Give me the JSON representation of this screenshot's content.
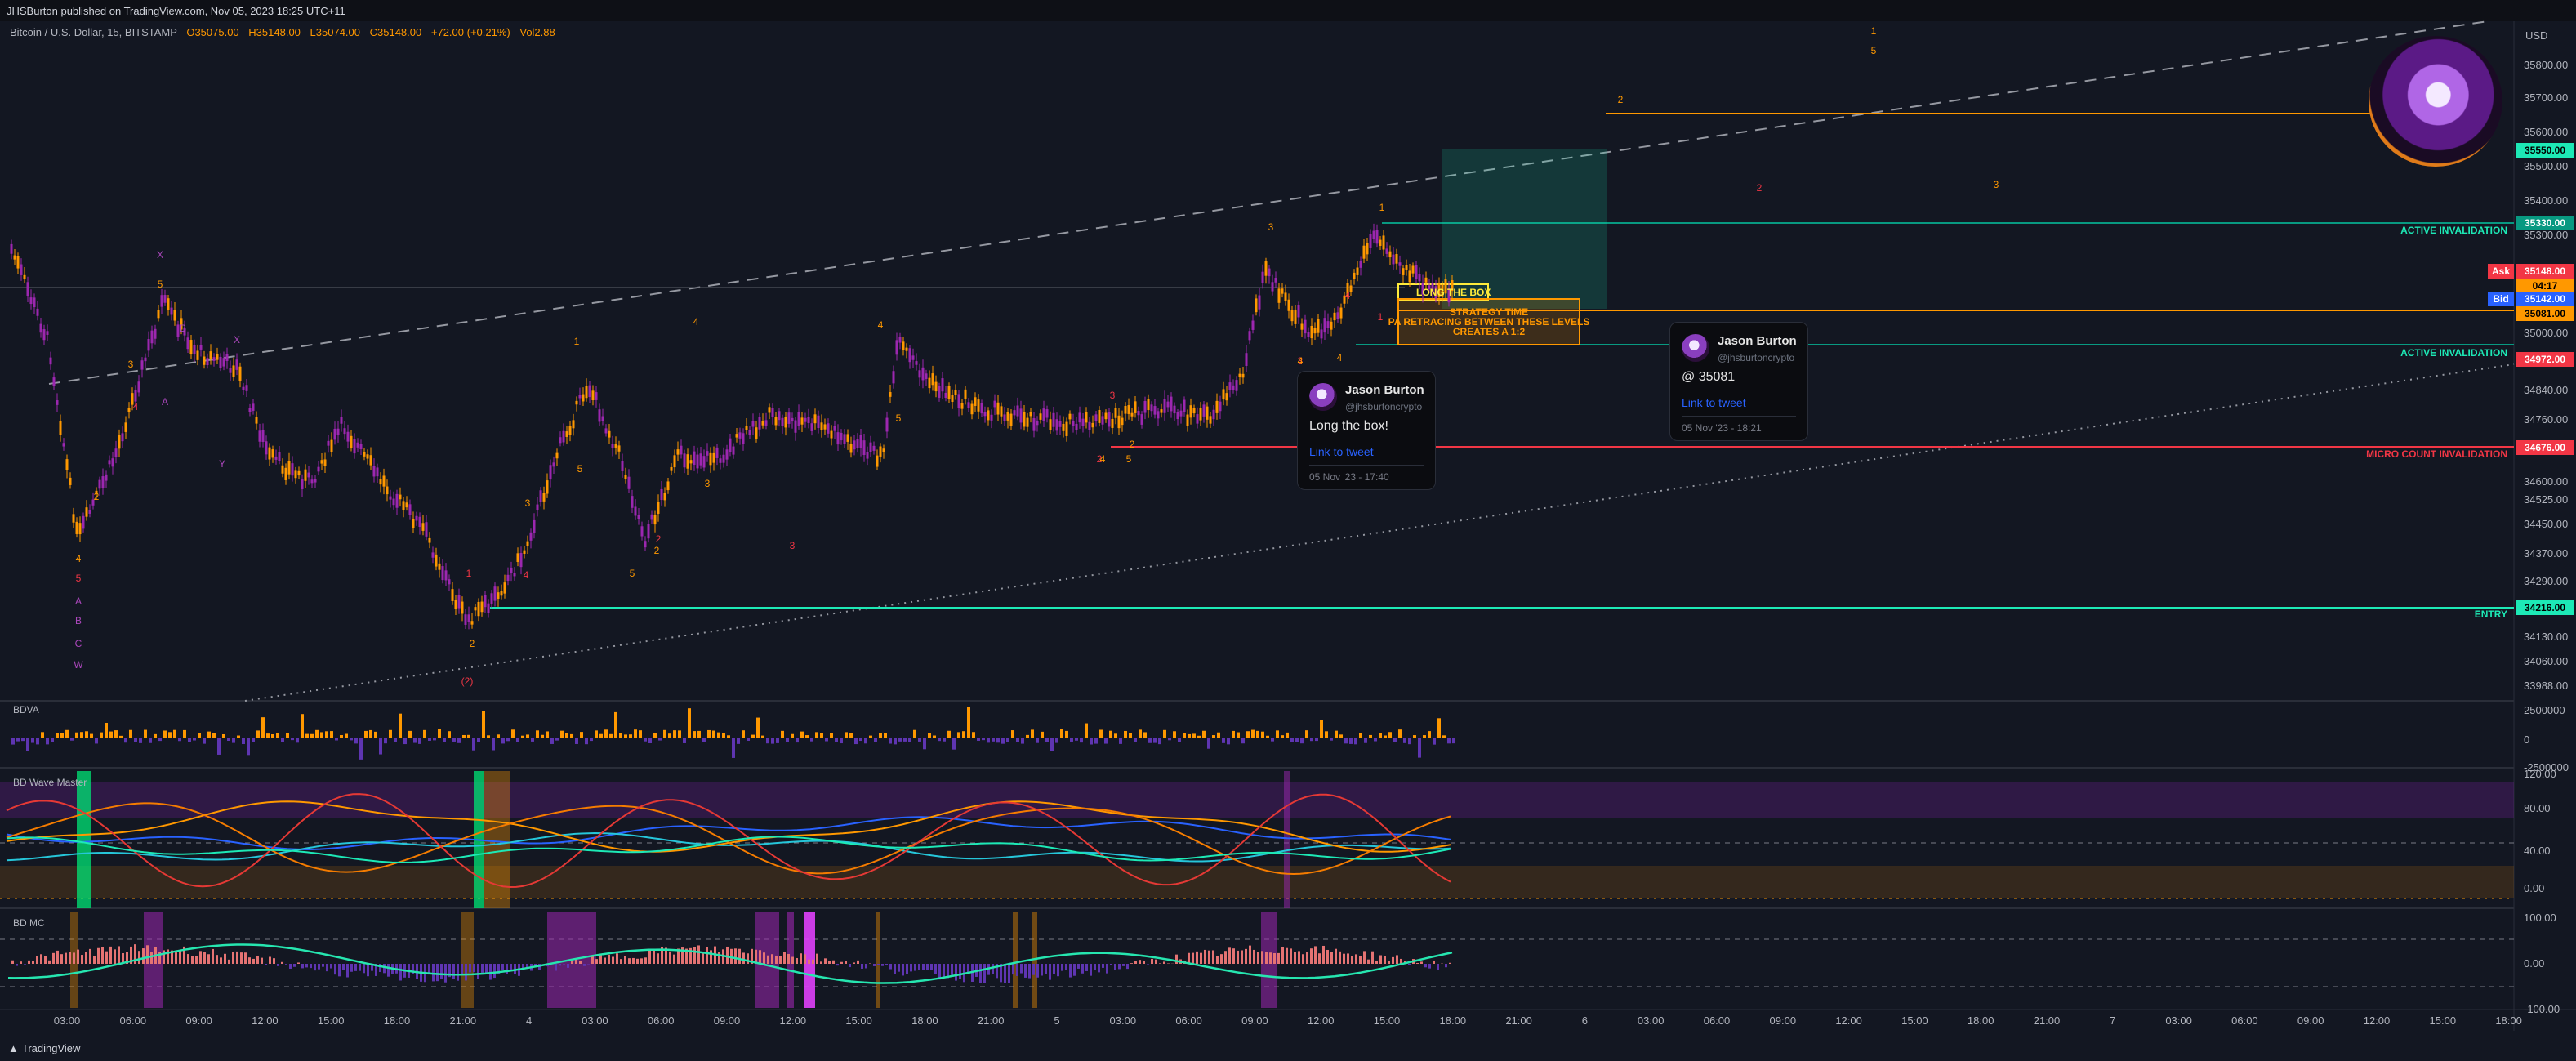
{
  "header": {
    "publisher": "JHSBurton published on TradingView.com, Nov 05, 2023 18:25 UTC+11"
  },
  "symbol": {
    "description": "Bitcoin / U.S. Dollar, 15, BITSTAMP",
    "open": "O35075.00",
    "high": "H35148.00",
    "low": "L35074.00",
    "close": "C35148.00",
    "change": "+72.00 (+0.21%)",
    "volume": "Vol2.88"
  },
  "price_axis": {
    "currency": "USD",
    "ticks": [
      "35800.00",
      "35700.00",
      "35600.00",
      "35500.00",
      "35400.00",
      "35300.00",
      "35000.00",
      "34840.00",
      "34760.00",
      "34600.00",
      "34525.00",
      "34450.00",
      "34370.00",
      "34290.00",
      "34130.00",
      "34060.00",
      "33988.00"
    ],
    "tags": [
      {
        "label": "35550.00",
        "color": "#1de9b6",
        "text_color": "#000000"
      },
      {
        "label": "35330.00",
        "color": "#089981",
        "text_color": "#ffffff"
      },
      {
        "label": "35148.00",
        "color": "#f23645",
        "text_color": "#ffffff",
        "prefix": "Ask"
      },
      {
        "label": "04:17",
        "color": "#ff9800",
        "text_color": "#000000"
      },
      {
        "label": "35142.00",
        "color": "#2962ff",
        "text_color": "#ffffff",
        "prefix": "Bid"
      },
      {
        "label": "35081.00",
        "color": "#ff9800",
        "text_color": "#000000"
      },
      {
        "label": "34972.00",
        "color": "#f23645",
        "text_color": "#ffffff"
      },
      {
        "label": "34676.00",
        "color": "#f23645",
        "text_color": "#ffffff"
      },
      {
        "label": "34216.00",
        "color": "#1de9b6",
        "text_color": "#000000"
      }
    ]
  },
  "level_labels": {
    "active_invalidation": "ACTIVE INVALIDATION",
    "micro_count_invalidation": "MICRO COUNT INVALIDATION",
    "entry": "ENTRY"
  },
  "box_labels": {
    "long_box": "LONG THE BOX",
    "pa_note_1": "STRATEGY TIME",
    "pa_note_2": "PA RETRACING BETWEEN THESE LEVELS",
    "pa_note_3": "CREATES A 1:2"
  },
  "tweets": [
    {
      "name": "Jason Burton",
      "handle": "@jhsburtoncrypto",
      "text": "Long the box!",
      "link": "Link to tweet",
      "time": "05 Nov '23 - 17:40"
    },
    {
      "name": "Jason Burton",
      "handle": "@jhsburtoncrypto",
      "text": "@ 35081",
      "link": "Link to tweet",
      "time": "05 Nov '23 - 18:21"
    }
  ],
  "panes": {
    "bdva": {
      "title": "BDVA",
      "ticks": [
        "2500000",
        "0",
        "-2500000"
      ]
    },
    "wave": {
      "title": "BD Wave Master",
      "ticks": [
        "120.00",
        "80.00",
        "40.00",
        "0.00"
      ]
    },
    "mc": {
      "title": "BD MC",
      "ticks": [
        "100.00",
        "0.00",
        "-100.00"
      ]
    }
  },
  "time_axis": [
    "03:00",
    "06:00",
    "09:00",
    "12:00",
    "15:00",
    "18:00",
    "21:00",
    "4",
    "03:00",
    "06:00",
    "09:00",
    "12:00",
    "15:00",
    "18:00",
    "21:00",
    "5",
    "03:00",
    "06:00",
    "09:00",
    "12:00",
    "15:00",
    "18:00",
    "21:00",
    "6",
    "03:00",
    "06:00",
    "09:00",
    "12:00",
    "15:00",
    "18:00",
    "21:00",
    "7",
    "03:00",
    "06:00",
    "09:00",
    "12:00",
    "15:00",
    "18:00"
  ],
  "wave_labels": [
    "X",
    "5",
    "3",
    "4",
    "2",
    "X",
    "B",
    "A",
    "Y",
    "1",
    "3",
    "2",
    "4",
    "5",
    "2",
    "(2)",
    "1",
    "5",
    "2",
    "3",
    "4",
    "3",
    "4",
    "5",
    "2",
    "5",
    "3",
    "3",
    "4",
    "1",
    "4",
    "2",
    "5",
    "2",
    "3",
    "1",
    "3",
    "4",
    "2",
    "1",
    "4",
    "W",
    "C",
    "A",
    "B",
    "5",
    "4"
  ],
  "footer": {
    "brand": "TradingView"
  },
  "colors": {
    "background": "#131722",
    "bull": "#ff9800",
    "bear": "#9c27b0",
    "accent_green": "#1de9b6",
    "accent_orange": "#ff9800",
    "accent_red": "#f23645"
  }
}
